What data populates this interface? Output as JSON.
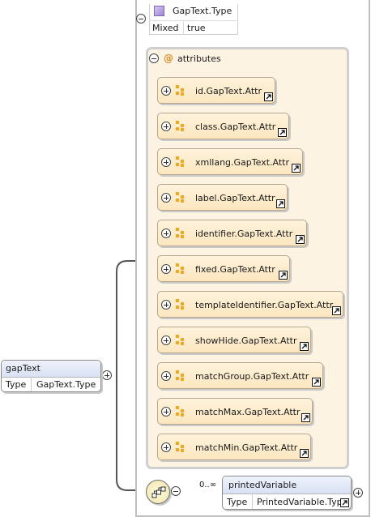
{
  "type": {
    "name": "GapText.Type",
    "property_key": "Mixed",
    "property_value": "true"
  },
  "attributes": {
    "label": "attributes",
    "icon": "at-icon",
    "items": [
      "id.GapText.Attr",
      "class.GapText.Attr",
      "xmllang.GapText.Attr",
      "label.GapText.Attr",
      "identifier.GapText.Attr",
      "fixed.GapText.Attr",
      "templateIdentifier.GapText.Attr",
      "showHide.GapText.Attr",
      "matchGroup.GapText.Attr",
      "matchMax.GapText.Attr",
      "matchMin.GapText.Attr"
    ]
  },
  "element": {
    "name": "gapText",
    "type_key": "Type",
    "type_value": "GapText.Type"
  },
  "child": {
    "occurrence": "0..∞",
    "name": "printedVariable",
    "type_key": "Type",
    "type_value": "PrintedVariable.Type"
  },
  "colors": {
    "attribute_fill": "#fbe6bf",
    "group_fill": "#fdf3e3",
    "element_header": "#d8e1f4",
    "attribute_icon": "#f0a81c"
  }
}
